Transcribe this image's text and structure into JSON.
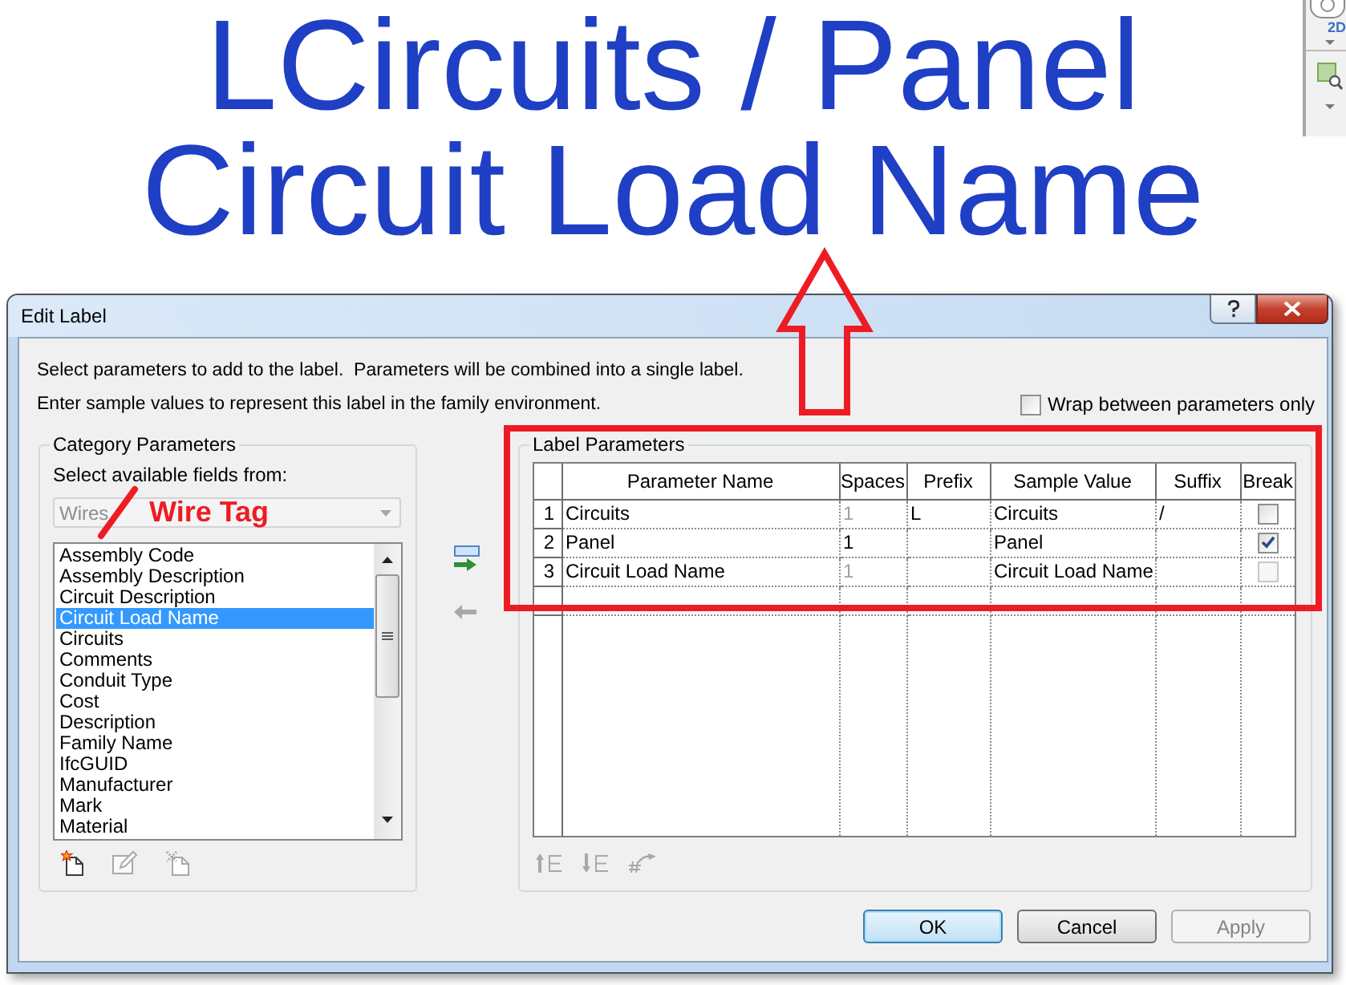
{
  "label_preview": {
    "lines": [
      "LCircuits / Panel",
      "Circuit Load Name"
    ]
  },
  "background_ribbon": {
    "view_label": "2D"
  },
  "annotation": {
    "callout": "Wire Tag"
  },
  "dialog": {
    "title": "Edit Label",
    "instructions": [
      "Select parameters to add to the label.  Parameters will be combined into a single label.",
      "Enter sample values to represent this label in the family environment."
    ],
    "wrap_option": {
      "label": "Wrap between parameters only",
      "checked": false
    },
    "category_parameters": {
      "title": "Category Parameters",
      "prompt": "Select available fields from:",
      "category": {
        "value": "Wires",
        "disabled": true
      },
      "fields": [
        {
          "label": "Assembly Code",
          "selected": false
        },
        {
          "label": "Assembly Description",
          "selected": false
        },
        {
          "label": "Circuit Description",
          "selected": false
        },
        {
          "label": "Circuit Load Name",
          "selected": true
        },
        {
          "label": "Circuits",
          "selected": false
        },
        {
          "label": "Comments",
          "selected": false
        },
        {
          "label": "Conduit Type",
          "selected": false
        },
        {
          "label": "Cost",
          "selected": false
        },
        {
          "label": "Description",
          "selected": false
        },
        {
          "label": "Family Name",
          "selected": false
        },
        {
          "label": "IfcGUID",
          "selected": false
        },
        {
          "label": "Manufacturer",
          "selected": false
        },
        {
          "label": "Mark",
          "selected": false
        },
        {
          "label": "Material",
          "selected": false
        }
      ],
      "tools": [
        {
          "kind": "new",
          "disabled": false
        },
        {
          "kind": "edit",
          "disabled": true
        },
        {
          "kind": "delete",
          "disabled": true
        }
      ]
    },
    "transfer_tools": [
      {
        "kind": "add",
        "disabled": false
      },
      {
        "kind": "remove",
        "disabled": true
      }
    ],
    "label_parameters": {
      "title": "Label Parameters",
      "columns": [
        "Parameter Name",
        "Spaces",
        "Prefix",
        "Sample Value",
        "Suffix",
        "Break"
      ],
      "rows": [
        {
          "number": "1",
          "parameter_name": "Circuits",
          "spaces": "1",
          "spaces_disabled": true,
          "prefix": "L",
          "sample_value": "Circuits",
          "suffix": "/",
          "break": {
            "checked": false,
            "disabled": false
          }
        },
        {
          "number": "2",
          "parameter_name": "Panel",
          "spaces": "1",
          "spaces_disabled": false,
          "sample_value": "Panel",
          "break": {
            "checked": true,
            "disabled": false
          }
        },
        {
          "number": "3",
          "parameter_name": "Circuit Load Name",
          "spaces": "1",
          "spaces_disabled": true,
          "sample_value": "Circuit Load Name",
          "break": {
            "checked": false,
            "disabled": true
          }
        }
      ],
      "tools": [
        {
          "kind": "move_up",
          "disabled": true
        },
        {
          "kind": "move_down",
          "disabled": true
        },
        {
          "kind": "format",
          "disabled": true
        }
      ]
    },
    "buttons": [
      {
        "label": "OK",
        "default": true,
        "disabled": false
      },
      {
        "label": "Cancel",
        "default": false,
        "disabled": false
      },
      {
        "label": "Apply",
        "default": false,
        "disabled": true
      }
    ]
  }
}
